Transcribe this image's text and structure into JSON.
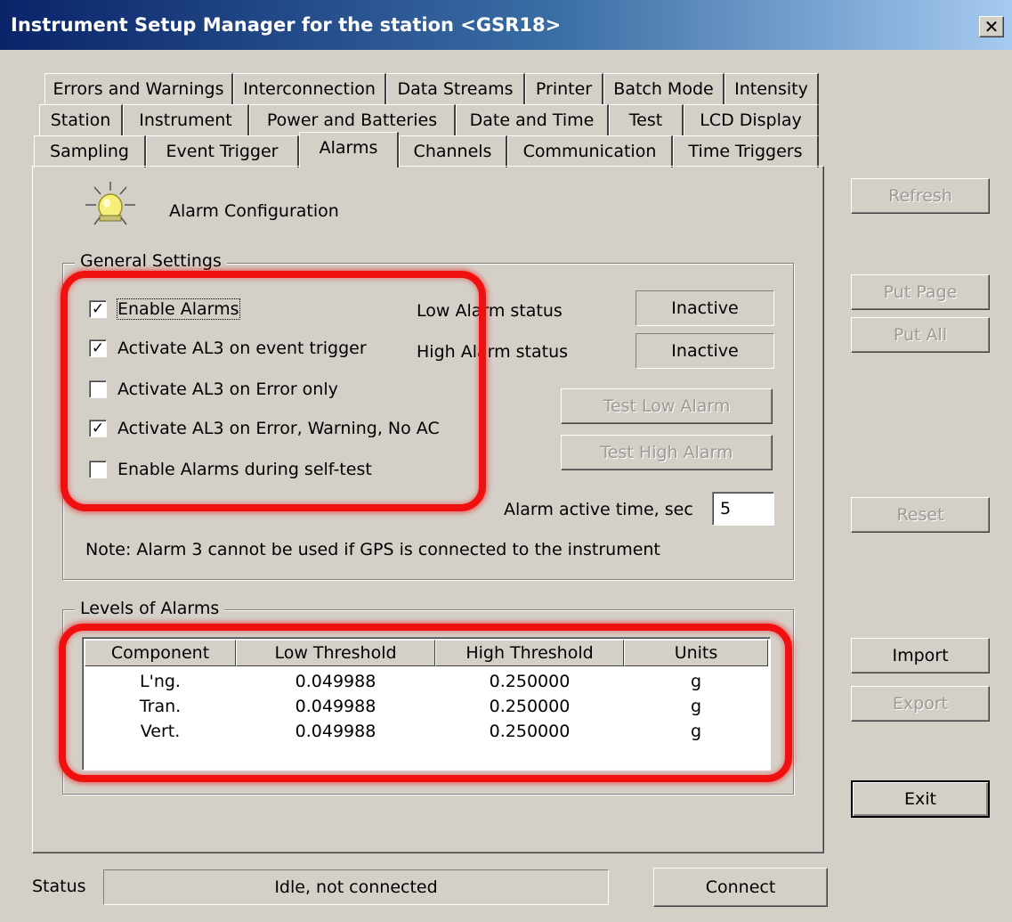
{
  "window": {
    "title": "Instrument Setup Manager for the station <GSR18>",
    "close_glyph": "✕"
  },
  "tabs": {
    "row1": [
      "Errors and Warnings",
      "Interconnection",
      "Data Streams",
      "Printer",
      "Batch Mode",
      "Intensity"
    ],
    "row2": [
      "Station",
      "Instrument",
      "Power and Batteries",
      "Date and Time",
      "Test",
      "LCD Display"
    ],
    "row3": [
      "Sampling",
      "Event Trigger",
      "Alarms",
      "Channels",
      "Communication",
      "Time Triggers"
    ],
    "active": "Alarms"
  },
  "page": {
    "icon": "alarm-light-icon",
    "title": "Alarm Configuration"
  },
  "general_settings": {
    "title": "General Settings",
    "checkboxes": [
      {
        "label": "Enable Alarms",
        "checked": true
      },
      {
        "label": "Activate AL3 on event trigger",
        "checked": true
      },
      {
        "label": "Activate AL3 on Error only",
        "checked": false
      },
      {
        "label": "Activate AL3 on Error, Warning, No AC",
        "checked": true
      },
      {
        "label": "Enable Alarms during self-test",
        "checked": false
      }
    ],
    "low_alarm_label": "Low Alarm status",
    "low_alarm_value": "Inactive",
    "high_alarm_label": "High Alarm status",
    "high_alarm_value": "Inactive",
    "test_low_button": "Test Low Alarm",
    "test_high_button": "Test High Alarm",
    "active_time_label": "Alarm active time, sec",
    "active_time_value": "5",
    "note": "Note: Alarm 3 cannot be used if GPS is connected to the instrument"
  },
  "levels": {
    "title": "Levels of Alarms",
    "columns": [
      "Component",
      "Low Threshold",
      "High Threshold",
      "Units"
    ],
    "rows": [
      [
        "L'ng.",
        "0.049988",
        "0.250000",
        "g"
      ],
      [
        "Tran.",
        "0.049988",
        "0.250000",
        "g"
      ],
      [
        "Vert.",
        "0.049988",
        "0.250000",
        "g"
      ]
    ]
  },
  "side_buttons": {
    "refresh": "Refresh",
    "put_page": "Put Page",
    "put_all": "Put All",
    "reset": "Reset",
    "import": "Import",
    "export": "Export",
    "exit": "Exit"
  },
  "status": {
    "label": "Status",
    "value": "Idle, not connected",
    "connect": "Connect"
  },
  "colors": {
    "face": "#d4d0c8",
    "title_dark": "#0a246a",
    "highlight_ring": "#f01010"
  }
}
